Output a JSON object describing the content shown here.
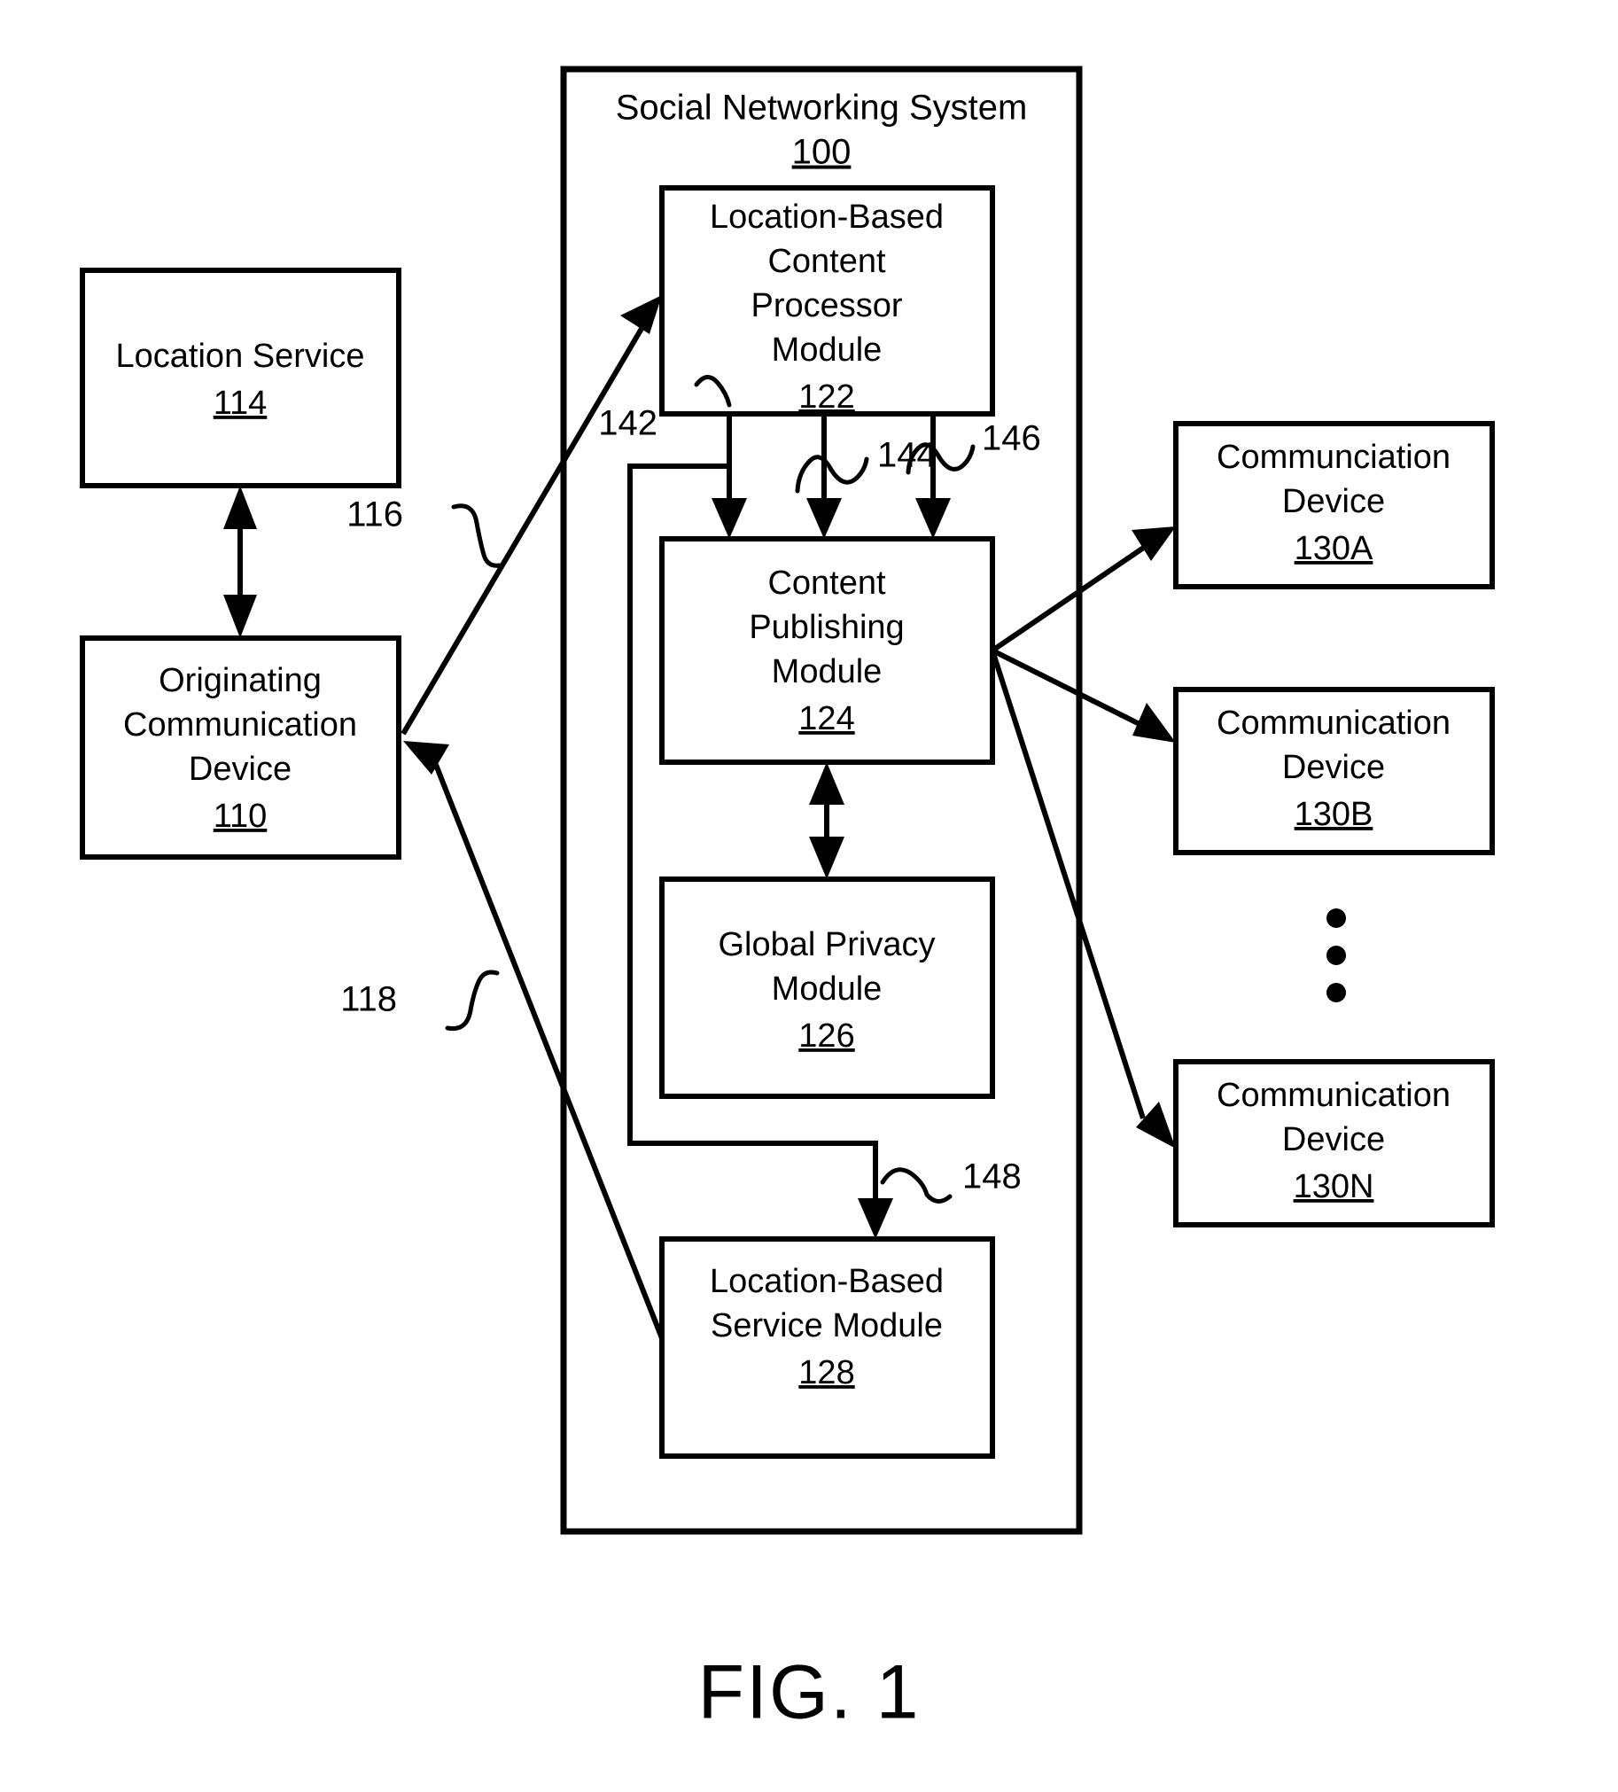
{
  "figure": {
    "caption": "FIG. 1"
  },
  "system": {
    "title": "Social Networking System",
    "ref": "100"
  },
  "boxes": {
    "location_service": {
      "lines": [
        "Location Service"
      ],
      "ref": "114"
    },
    "originating_device": {
      "lines": [
        "Originating",
        "Communication",
        "Device"
      ],
      "ref": "110"
    },
    "content_processor": {
      "lines": [
        "Location-Based",
        "Content",
        "Processor",
        "Module"
      ],
      "ref": "122"
    },
    "content_publishing": {
      "lines": [
        "Content",
        "Publishing",
        "Module"
      ],
      "ref": "124"
    },
    "global_privacy": {
      "lines": [
        "Global Privacy",
        "Module"
      ],
      "ref": "126"
    },
    "location_service_module": {
      "lines": [
        "Location-Based",
        "Service Module"
      ],
      "ref": "128"
    },
    "device_a": {
      "lines": [
        "Communciation",
        "Device"
      ],
      "ref": "130A"
    },
    "device_b": {
      "lines": [
        "Communication",
        "Device"
      ],
      "ref": "130B"
    },
    "device_n": {
      "lines": [
        "Communication",
        "Device"
      ],
      "ref": "130N"
    }
  },
  "flow_labels": {
    "l116": "116",
    "l118": "118",
    "l142": "142",
    "l144": "144",
    "l146": "146",
    "l148": "148"
  },
  "colors": {
    "stroke": "#000000",
    "fill": "#ffffff"
  }
}
